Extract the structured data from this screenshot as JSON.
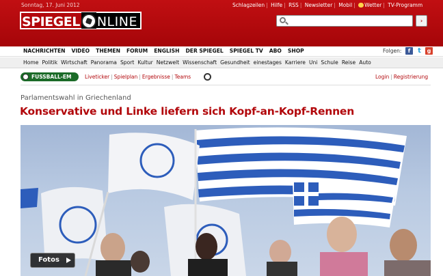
{
  "header": {
    "date": "Sonntag, 17. Juni 2012",
    "toplinks": [
      "Schlagzeilen",
      "Hilfe",
      "RSS",
      "Newsletter",
      "Mobil",
      "Wetter",
      "TV-Programm"
    ],
    "logo_part1": "SPIEGEL",
    "logo_part2": "NLINE",
    "search_placeholder": "",
    "search_button": "›",
    "brand_color": "#b2070b"
  },
  "mainnav": {
    "items": [
      "NACHRICHTEN",
      "VIDEO",
      "THEMEN",
      "FORUM",
      "ENGLISH",
      "DER SPIEGEL",
      "SPIEGEL TV",
      "ABO",
      "SHOP"
    ],
    "follow_label": "Folgen:",
    "social_icons": [
      "facebook-icon",
      "twitter-icon",
      "googleplus-icon"
    ]
  },
  "subnav": {
    "items": [
      "Home",
      "Politik",
      "Wirtschaft",
      "Panorama",
      "Sport",
      "Kultur",
      "Netzwelt",
      "Wissenschaft",
      "Gesundheit",
      "einestages",
      "Karriere",
      "Uni",
      "Schule",
      "Reise",
      "Auto"
    ]
  },
  "em": {
    "badge": "FUSSBALL-EM",
    "links": [
      "Liveticker",
      "Spielplan",
      "Ergebnisse",
      "Teams"
    ],
    "login": "Login",
    "register": "Registrierung"
  },
  "article": {
    "kicker": "Parlamentswahl in Griechenland",
    "headline": "Konservative und Linke liefern sich Kopf-an-Kopf-Rennen",
    "photo_button": "Fotos"
  }
}
